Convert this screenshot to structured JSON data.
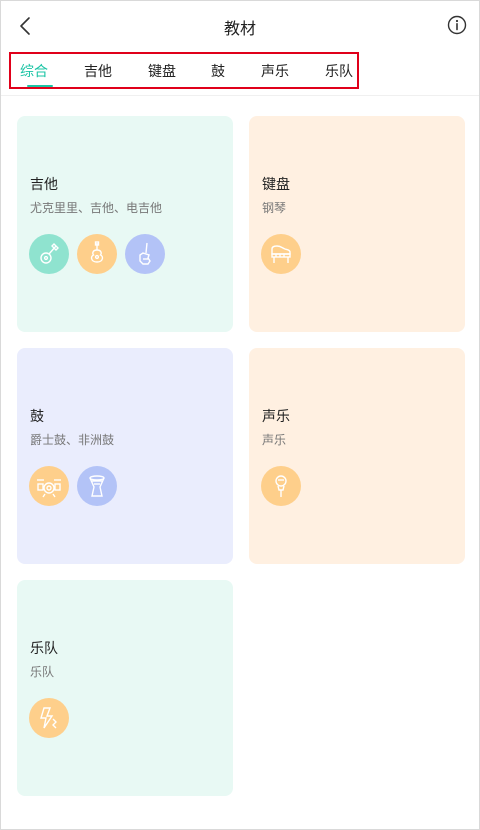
{
  "header": {
    "title": "教材"
  },
  "tabs": [
    {
      "label": "综合"
    },
    {
      "label": "吉他"
    },
    {
      "label": "键盘"
    },
    {
      "label": "鼓"
    },
    {
      "label": "声乐"
    },
    {
      "label": "乐队"
    }
  ],
  "cards": [
    {
      "title": "吉他",
      "subtitle": "尤克里里、吉他、电吉他",
      "bg": "#e8f9f4",
      "icons": [
        {
          "name": "ukulele-icon",
          "color": "#8fe3cf"
        },
        {
          "name": "acoustic-guitar-icon",
          "color": "#fecf8b"
        },
        {
          "name": "electric-guitar-icon",
          "color": "#b3c3f7"
        }
      ]
    },
    {
      "title": "键盘",
      "subtitle": "钢琴",
      "bg": "#fff0e1",
      "icons": [
        {
          "name": "piano-icon",
          "color": "#fecf8b"
        }
      ]
    },
    {
      "title": "鼓",
      "subtitle": "爵士鼓、非洲鼓",
      "bg": "#eaedfd",
      "icons": [
        {
          "name": "drum-kit-icon",
          "color": "#fecf8b"
        },
        {
          "name": "djembe-icon",
          "color": "#b3c3f7"
        }
      ]
    },
    {
      "title": "声乐",
      "subtitle": "声乐",
      "bg": "#fff0e1",
      "icons": [
        {
          "name": "microphone-icon",
          "color": "#fecf8b"
        }
      ]
    },
    {
      "title": "乐队",
      "subtitle": "乐队",
      "bg": "#e8f9f4",
      "icons": [
        {
          "name": "band-lightning-icon",
          "color": "#fecf8b"
        }
      ]
    }
  ],
  "colors": {
    "accent": "#1bc4a5",
    "highlight_border": "#e0001a"
  }
}
